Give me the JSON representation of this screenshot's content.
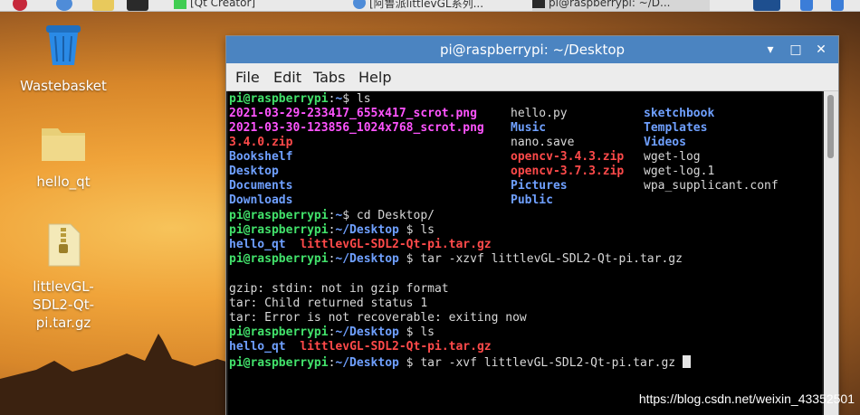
{
  "desktop": {
    "icons": [
      {
        "label": "Wastebasket"
      },
      {
        "label": "hello_qt"
      },
      {
        "label": "littlevGL-SDL2-Qt-pi.tar.gz"
      }
    ],
    "watermark": "https://blog.csdn.net/weixin_43352501"
  },
  "taskbar": {
    "qt_creator_label": "[Qt Creator]",
    "browser_label": "[阿鲁派littlevGL系列...",
    "terminal_label": "pi@raspberrypi: ~/D..."
  },
  "terminal": {
    "title": "pi@raspberrypi: ~/Desktop",
    "menu": [
      "File",
      "Edit",
      "Tabs",
      "Help"
    ],
    "prompt_user": "pi@raspberrypi",
    "lines": {
      "l1": {
        "path": "~",
        "cmd": "ls"
      },
      "ls1": {
        "col1": [
          "2021-03-29-233417_655x417_scrot.png",
          "2021-03-30-123856_1024x768_scrot.png",
          "3.4.0.zip",
          "Bookshelf",
          "Desktop",
          "Documents",
          "Downloads"
        ],
        "col2": [
          "hello.py",
          "Music",
          "nano.save",
          "opencv-3.4.3.zip",
          "opencv-3.7.3.zip",
          "Pictures",
          "Public"
        ],
        "col3": [
          "sketchbook",
          "Templates",
          "Videos",
          "wget-log",
          "wget-log.1",
          "wpa_supplicant.conf"
        ]
      },
      "l9": {
        "path": "~",
        "cmd": "cd Desktop/"
      },
      "l10": {
        "path": "~/Desktop",
        "cmd": "ls"
      },
      "ls2": {
        "dir": "hello_qt",
        "archive": "littlevGL-SDL2-Qt-pi.tar.gz"
      },
      "l12": {
        "path": "~/Desktop",
        "cmd": "tar -xzvf littlevGL-SDL2-Qt-pi.tar.gz"
      },
      "err1": "gzip: stdin: not in gzip format",
      "err2": "tar: Child returned status 1",
      "err3": "tar: Error is not recoverable: exiting now",
      "l17": {
        "path": "~/Desktop",
        "cmd": "ls"
      },
      "ls3": {
        "dir": "hello_qt",
        "archive": "littlevGL-SDL2-Qt-pi.tar.gz"
      },
      "l19": {
        "path": "~/Desktop",
        "cmd": "tar -xvf littlevGL-SDL2-Qt-pi.tar.gz"
      }
    }
  },
  "colors": {
    "titlebar": "#4b84c1",
    "prompt": "#42e26b",
    "directory": "#6fa0ff",
    "image": "#ff54ff",
    "archive": "#ff4a4a"
  }
}
